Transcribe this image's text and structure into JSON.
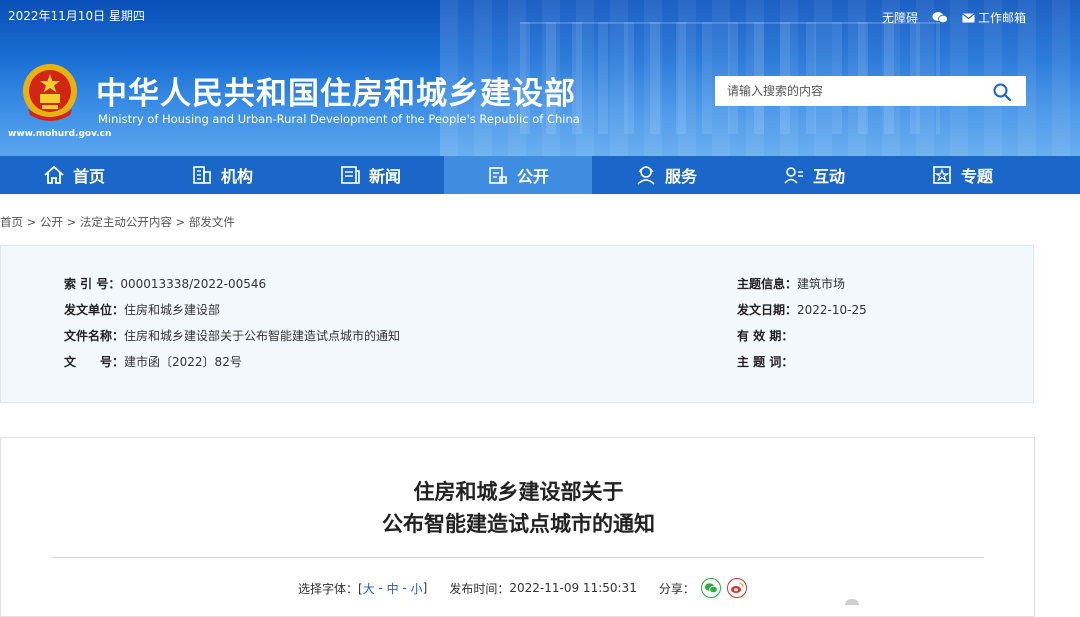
{
  "header": {
    "date": "2022年11月10日 星期四",
    "accessibility": "无障碍",
    "mail": "工作邮箱",
    "site_title": "中华人民共和国住房和城乡建设部",
    "site_subtitle": "Ministry of Housing and Urban-Rural Development of the People's Republic of China",
    "site_url": "www.mohurd.gov.cn",
    "search_placeholder": "请输入搜索的内容"
  },
  "nav": {
    "items": [
      {
        "label": "首页",
        "icon": "home-icon"
      },
      {
        "label": "机构",
        "icon": "building-icon"
      },
      {
        "label": "新闻",
        "icon": "news-icon"
      },
      {
        "label": "公开",
        "icon": "document-icon",
        "active": true
      },
      {
        "label": "服务",
        "icon": "service-icon"
      },
      {
        "label": "互动",
        "icon": "interact-icon"
      },
      {
        "label": "专题",
        "icon": "topic-icon"
      }
    ]
  },
  "breadcrumb": "首页 > 公开 > 法定主动公开内容 > 部发文件",
  "info": {
    "index_label": "索 引 号：",
    "index_value": "000013338/2022-00546",
    "issuer_label": "发文单位：",
    "issuer_value": "住房和城乡建设部",
    "filename_label": "文件名称：",
    "filename_value": "住房和城乡建设部关于公布智能建造试点城市的通知",
    "docno_label": "文　　号：",
    "docno_value": "建市函〔2022〕82号",
    "topic_label": "主题信息：",
    "topic_value": "建筑市场",
    "date_label": "发文日期：",
    "date_value": "2022-10-25",
    "valid_label": "有 效 期：",
    "valid_value": "",
    "keyword_label": "主 题 词：",
    "keyword_value": ""
  },
  "article": {
    "title_line1": "住房和城乡建设部关于",
    "title_line2": "公布智能建造试点城市的通知",
    "font_label": "选择字体：[ ",
    "font_large": "大",
    "font_medium": "中",
    "font_small": "小",
    "font_end": " ]",
    "publish_label": "发布时间：",
    "publish_time": "2022-11-09 11:50:31",
    "share_label": "分享："
  },
  "colors": {
    "nav_bg": "#1a66c9",
    "nav_active": "#3f8de0",
    "accent": "#1a66c9"
  }
}
